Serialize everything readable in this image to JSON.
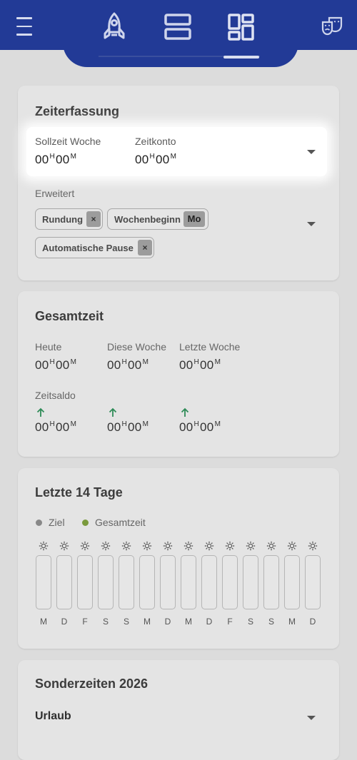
{
  "colors": {
    "brand": "#223a96",
    "ziel_dot": "#888888",
    "gesamt_dot": "#7a9a3c",
    "arrow": "#2e8b57"
  },
  "topbar": {
    "icons": [
      "menu-icon",
      "rocket-icon",
      "list-view-icon",
      "dashboard-icon",
      "theater-masks-icon"
    ],
    "active_tab": "dashboard"
  },
  "zeiterfassung": {
    "title": "Zeiterfassung",
    "soll_label": "Sollzeit Woche",
    "soll_h": "00",
    "soll_m": "00",
    "konto_label": "Zeitkonto",
    "konto_h": "00",
    "konto_m": "00",
    "erweitert_label": "Erweitert",
    "chips": {
      "rundung": "Rundung",
      "wochenbeginn": "Wochenbeginn",
      "wochenbeginn_value": "Mo",
      "pause": "Automatische Pause",
      "remove": "×"
    }
  },
  "gesamtzeit": {
    "title": "Gesamtzeit",
    "heute_label": "Heute",
    "woche_label": "Diese Woche",
    "letzte_label": "Letzte Woche",
    "heute_h": "00",
    "heute_m": "00",
    "woche_h": "00",
    "woche_m": "00",
    "letzte_h": "00",
    "letzte_m": "00",
    "saldo_label": "Zeitsaldo",
    "saldo1_h": "00",
    "saldo1_m": "00",
    "saldo2_h": "00",
    "saldo2_m": "00",
    "saldo3_h": "00",
    "saldo3_m": "00",
    "unit_h": "H",
    "unit_m": "M"
  },
  "letzte14": {
    "title": "Letzte 14 Tage",
    "legend_ziel": "Ziel",
    "legend_gesamt": "Gesamtzeit",
    "days": [
      "M",
      "D",
      "F",
      "S",
      "S",
      "M",
      "D",
      "M",
      "D",
      "F",
      "S",
      "S",
      "M",
      "D"
    ]
  },
  "sonderzeiten": {
    "title": "Sonderzeiten 2026",
    "urlaub": "Urlaub"
  }
}
